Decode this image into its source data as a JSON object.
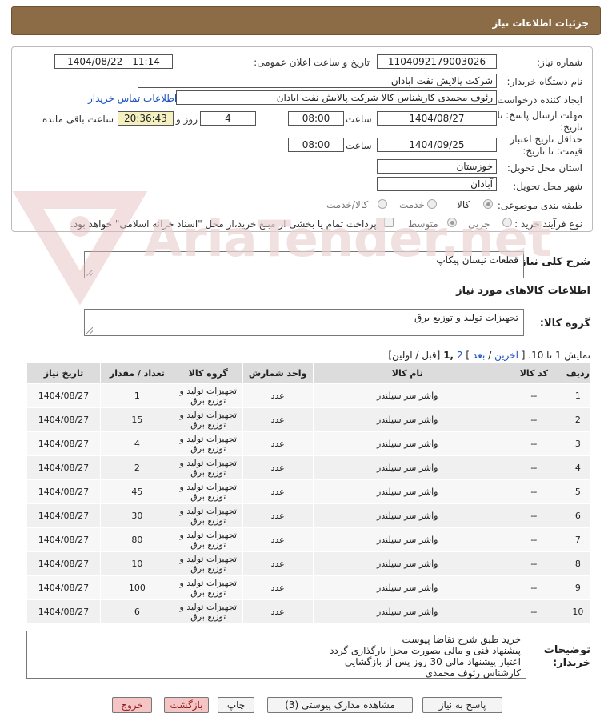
{
  "window_title": "جزئیات اطلاعات نیاز",
  "fields": {
    "need_number_label": "شماره نیاز:",
    "need_number": "1104092179003026",
    "announce_label": "تاریخ و ساعت اعلان عمومی:",
    "announce_value": "1404/08/22 - 11:14",
    "buyer_org_label": "نام دستگاه خریدار:",
    "buyer_org": "شرکت پالایش نفت ابادان",
    "creator_label": "ایجاد کننده درخواست:",
    "creator": "رئوف محمدی کارشناس کالا شرکت پالایش نفت ابادان",
    "contact_link": "اطلاعات تماس خریدار",
    "deadline_label_1": "مهلت ارسال پاسخ: تا",
    "deadline_label_2": "تاریخ:",
    "deadline_date": "1404/08/27",
    "time_label": "ساعت",
    "deadline_time": "08:00",
    "days_value": "4",
    "days_label": "روز و",
    "remaining_time": "20:36:43",
    "remaining_label": "ساعت باقی مانده",
    "validity_label_1": "حداقل تاریخ اعتبار",
    "validity_label_2": "قیمت: تا تاریخ:",
    "validity_date": "1404/09/25",
    "validity_time": "08:00",
    "province_label": "استان محل تحویل:",
    "province": "خوزستان",
    "city_label": "شهر محل تحویل:",
    "city": "آبادان",
    "category_label": "طبقه بندی موضوعی:",
    "category_options": [
      "کالا",
      "خدمت",
      "کالا/خدمت"
    ],
    "process_label": "نوع فرآیند خرید :",
    "process_options": [
      "جزیی",
      "متوسط"
    ],
    "payment_note": "پرداخت تمام یا بخشی از مبلغ خرید،از محل \"اسناد خزانه اسلامی\" خواهد بود."
  },
  "description": {
    "label": "شرح کلی نیاز:",
    "value": "قطعات نیسان پیکاپ"
  },
  "goods_section_title": "اطلاعات کالاهای مورد نیاز",
  "goods_group": {
    "label": "گروه کالا:",
    "value": "تجهیزات تولید و توزیع برق"
  },
  "pagination": {
    "prefix": "نمایش 1 تا 10. [",
    "last": "آخرین",
    "slash": "/",
    "next": "بعد",
    "page2": "2",
    "page1": ",1",
    "suffix": "[قبل / اولین]"
  },
  "table": {
    "headers": [
      "ردیف",
      "کد کالا",
      "نام کالا",
      "واحد شمارش",
      "گروه کالا",
      "تعداد / مقدار",
      "تاریخ نیاز"
    ],
    "group_line1": "تجهیزات تولید و",
    "group_line2": "توزیع برق",
    "rows": [
      {
        "row": "1",
        "code": "--",
        "name": "واشر سر سیلندر",
        "unit": "عدد",
        "qty": "1",
        "date": "1404/08/27"
      },
      {
        "row": "2",
        "code": "--",
        "name": "واشر سر سیلندر",
        "unit": "عدد",
        "qty": "15",
        "date": "1404/08/27"
      },
      {
        "row": "3",
        "code": "--",
        "name": "واشر سر سیلندر",
        "unit": "عدد",
        "qty": "4",
        "date": "1404/08/27"
      },
      {
        "row": "4",
        "code": "--",
        "name": "واشر سر سیلندر",
        "unit": "عدد",
        "qty": "2",
        "date": "1404/08/27"
      },
      {
        "row": "5",
        "code": "--",
        "name": "واشر سر سیلندر",
        "unit": "عدد",
        "qty": "45",
        "date": "1404/08/27"
      },
      {
        "row": "6",
        "code": "--",
        "name": "واشر سر سیلندر",
        "unit": "عدد",
        "qty": "30",
        "date": "1404/08/27"
      },
      {
        "row": "7",
        "code": "--",
        "name": "واشر سر سیلندر",
        "unit": "عدد",
        "qty": "80",
        "date": "1404/08/27"
      },
      {
        "row": "8",
        "code": "--",
        "name": "واشر سر سیلندر",
        "unit": "عدد",
        "qty": "10",
        "date": "1404/08/27"
      },
      {
        "row": "9",
        "code": "--",
        "name": "واشر سر سیلندر",
        "unit": "عدد",
        "qty": "100",
        "date": "1404/08/27"
      },
      {
        "row": "10",
        "code": "--",
        "name": "واشر سر سیلندر",
        "unit": "عدد",
        "qty": "6",
        "date": "1404/08/27"
      }
    ]
  },
  "buyer_notes": {
    "label_1": "توضیحات",
    "label_2": "خریدار:",
    "lines": [
      "خرید طبق شرح تقاضا پیوست",
      "پیشنهاد فنی و مالی بصورت مجزا بارگذاری گردد",
      "اعتبار پیشنهاد مالی 30 روز پس از بازگشایی",
      "کارشناس رئوف محمدی"
    ]
  },
  "buttons": {
    "reply": "پاسخ به نیاز",
    "attachments": "مشاهده مدارک پیوستی (3)",
    "print": "چاپ",
    "back": "بازگشت",
    "exit": "خروج"
  },
  "watermark": "AriaTender.net",
  "colors": {
    "titlebar": "#8c6b47",
    "link": "#1a4fbf",
    "highlight": "#f4f0c0",
    "watermark": "#e7d0d0"
  }
}
